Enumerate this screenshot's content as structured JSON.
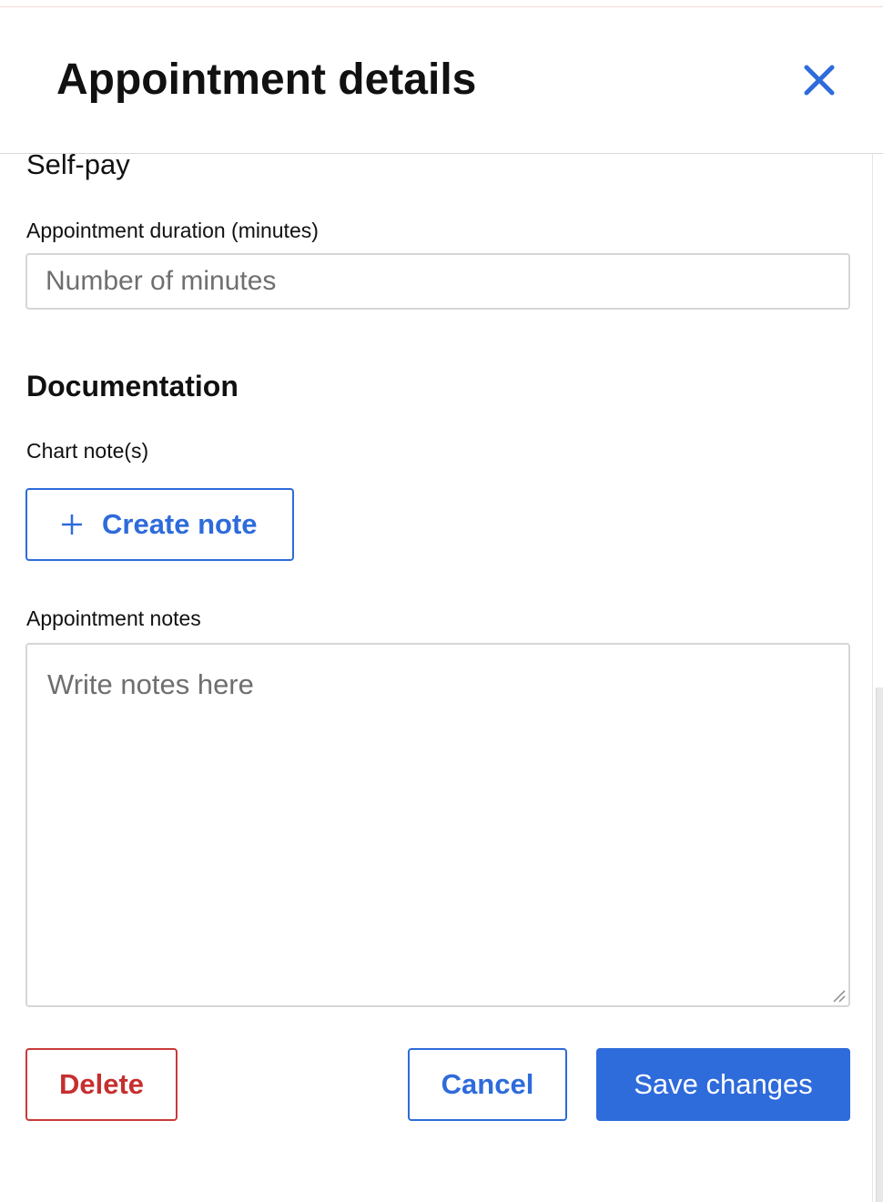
{
  "header": {
    "title": "Appointment details",
    "close_icon": "close-icon"
  },
  "colors": {
    "accent": "#2e6bdb",
    "danger": "#c62f2f",
    "border": "#d6d6d6",
    "placeholder": "#6f6f6f"
  },
  "billing": {
    "value": "Self-pay"
  },
  "duration": {
    "label": "Appointment duration (minutes)",
    "placeholder": "Number of minutes",
    "value": ""
  },
  "documentation": {
    "heading": "Documentation",
    "chart_notes_label": "Chart note(s)",
    "create_note_label": "Create note",
    "create_note_icon": "plus-icon"
  },
  "notes": {
    "label": "Appointment notes",
    "placeholder": "Write notes here",
    "value": ""
  },
  "actions": {
    "delete_label": "Delete",
    "cancel_label": "Cancel",
    "save_label": "Save changes"
  }
}
